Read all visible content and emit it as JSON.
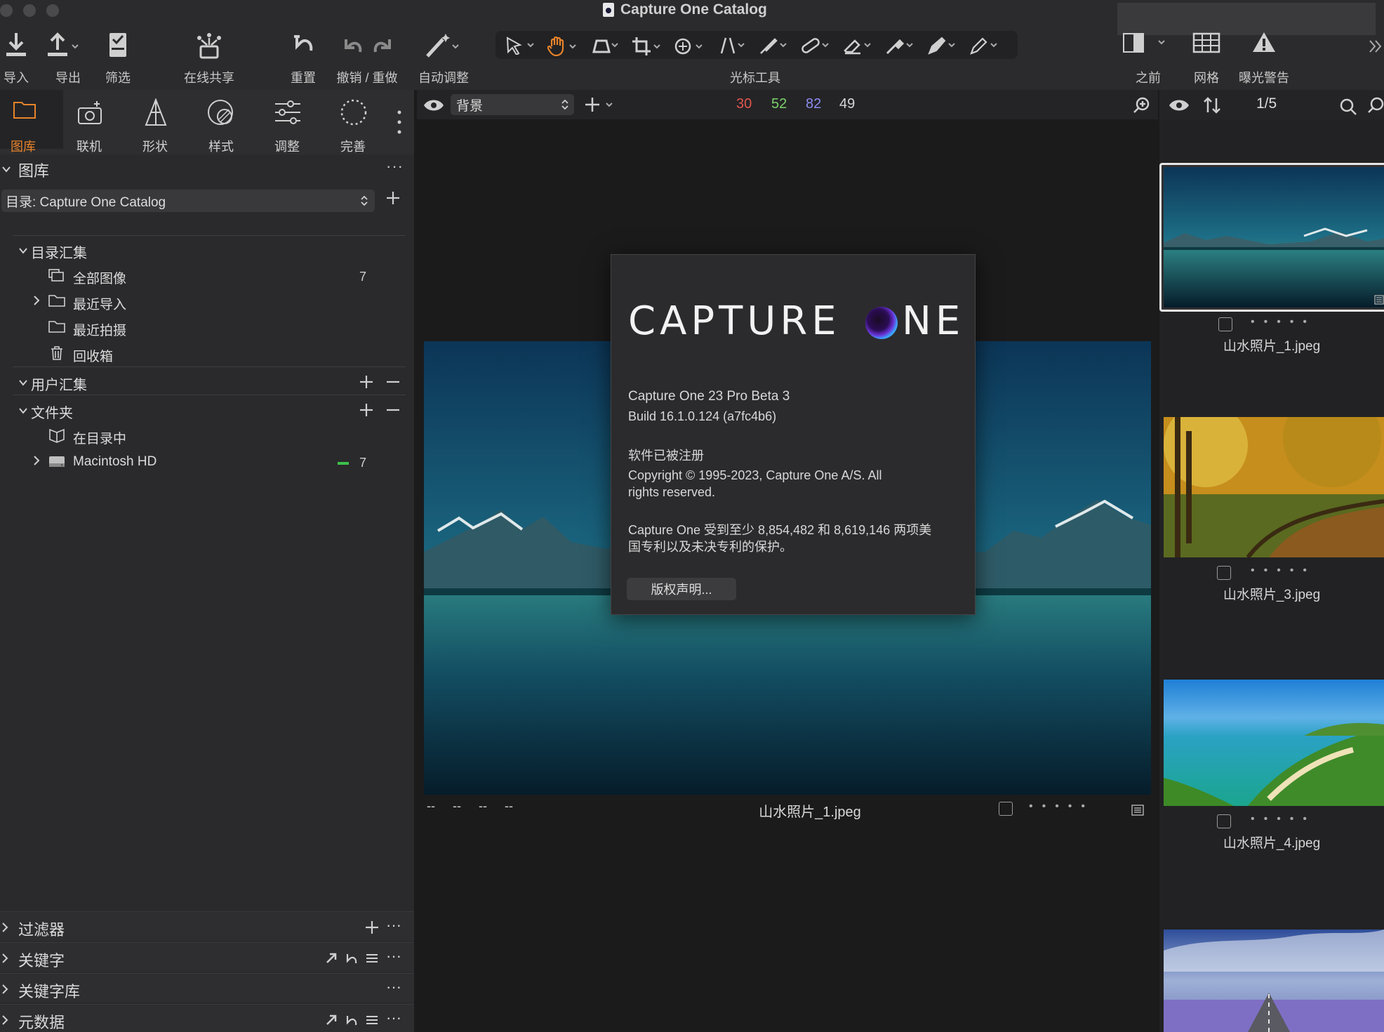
{
  "window": {
    "title": "Capture One Catalog"
  },
  "toolbar": {
    "import": "导入",
    "export": "导出",
    "filter": "筛选",
    "share": "在线共享",
    "reset": "重置",
    "undo_redo": "撤销 / 重做",
    "auto_adjust": "自动调整",
    "cursor_tools": "光标工具",
    "before": "之前",
    "grid": "网格",
    "exposure_warning": "曝光警告"
  },
  "left_tabs": [
    {
      "label": "图库",
      "icon": "folder-icon",
      "active": true
    },
    {
      "label": "联机",
      "icon": "camera-icon"
    },
    {
      "label": "形状",
      "icon": "lens-icon"
    },
    {
      "label": "样式",
      "icon": "styles-icon"
    },
    {
      "label": "调整",
      "icon": "sliders-icon"
    },
    {
      "label": "完善",
      "icon": "refine-icon"
    }
  ],
  "library": {
    "title": "图库",
    "catalog_select": "目录: Capture One Catalog",
    "catalog_collections": "目录汇集",
    "items": [
      {
        "label": "全部图像",
        "count": "7"
      },
      {
        "label": "最近导入"
      },
      {
        "label": "最近拍摄"
      },
      {
        "label": "回收箱"
      }
    ],
    "user_collections": "用户汇集",
    "folders": "文件夹",
    "folder_items": [
      {
        "label": "在目录中"
      },
      {
        "label": "Macintosh HD",
        "count": "7"
      }
    ]
  },
  "bottom_sections": [
    "过滤器",
    "关键字",
    "关键字库",
    "元数据"
  ],
  "viewer": {
    "layer_select": "背景",
    "rgb": {
      "r": "30",
      "g": "52",
      "b": "82",
      "l": "49"
    },
    "meta": [
      "--",
      "--",
      "--",
      "--"
    ],
    "filename": "山水照片_1.jpeg"
  },
  "browser": {
    "counter": "1/5",
    "thumbnails": [
      {
        "name": "山水照片_1.jpeg"
      },
      {
        "name": "山水照片_3.jpeg"
      },
      {
        "name": "山水照片_4.jpeg"
      }
    ]
  },
  "about": {
    "logo_left": "CAPTURE",
    "logo_right": "NE",
    "version": "Capture One 23 Pro  Beta 3",
    "build": "Build 16.1.0.124 (a7fc4b6)",
    "registered": "软件已被注册",
    "copyright_1": "Copyright © 1995-2023, Capture One A/S. All",
    "copyright_2": "rights reserved.",
    "patent_1": "Capture One 受到至少 8,854,482 和 8,619,146 两项美",
    "patent_2": "国专利以及未决专利的保护。",
    "notice_button": "版权声明..."
  },
  "colors": {
    "accent": "#e8832a",
    "red": "#e0554f",
    "green": "#7cd16b",
    "blue": "#8d8cf2"
  }
}
